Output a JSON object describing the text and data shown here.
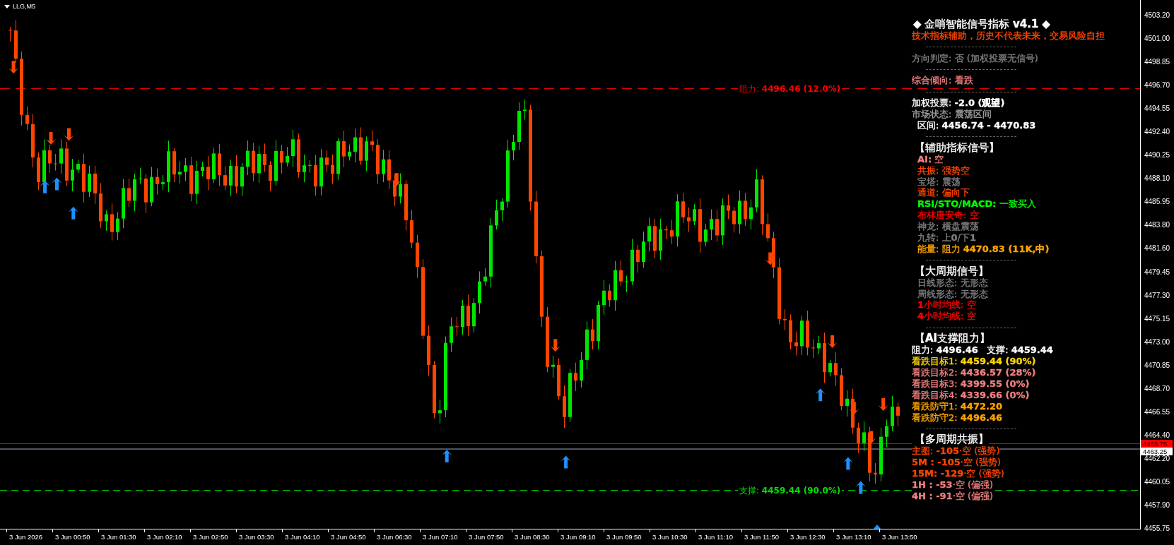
{
  "symbol": "LLG,M5",
  "levels": [
    {
      "kind": "resistance",
      "label": "阻力: **4496.46 (12.0%)**",
      "color": "#ff0000"
    },
    {
      "kind": "support",
      "label": "支撑: **4459.44 (90.0%)**",
      "color": "#00e000"
    }
  ],
  "price_axis": {
    "labels": [
      "4503.20",
      "4501.00",
      "4498.85",
      "4496.70",
      "4494.55",
      "4492.40",
      "4490.25",
      "4488.10",
      "4485.95",
      "4483.80",
      "4481.60",
      "4479.45",
      "4477.30",
      "4475.15",
      "4473.00",
      "4470.85",
      "4468.70",
      "4466.55",
      "4464.40",
      "4462.20",
      "4460.05",
      "4457.90",
      "4455.75"
    ],
    "ask": "4463.75",
    "bid": "4463.25"
  },
  "time_axis": [
    "3 Jun 2026",
    "3 Jun 00:50",
    "3 Jun 01:30",
    "3 Jun 02:10",
    "3 Jun 02:50",
    "3 Jun 03:30",
    "3 Jun 04:10",
    "3 Jun 04:50",
    "3 Jun 06:30",
    "3 Jun 07:10",
    "3 Jun 07:50",
    "3 Jun 08:30",
    "3 Jun 09:10",
    "3 Jun 09:50",
    "3 Jun 10:30",
    "3 Jun 11:10",
    "3 Jun 11:50",
    "3 Jun 12:30",
    "3 Jun 13:10",
    "3 Jun 13:50"
  ],
  "panel": {
    "rows": [
      {
        "kind": "title",
        "text": "◆ 金哨智能信号指标 **v4.1** ◆",
        "color": "#ffffff"
      },
      {
        "kind": "line",
        "text": "技术指标辅助，历史不代表未来，交易风险自担",
        "color": "#ff4500"
      },
      {
        "kind": "separator"
      },
      {
        "kind": "line",
        "text": "方向判定: 否 (加权投票无信号)",
        "color": "#808080"
      },
      {
        "kind": "separator"
      },
      {
        "kind": "line",
        "text": "综合倾向: 看跌",
        "color": "#f08080"
      },
      {
        "kind": "separator"
      },
      {
        "kind": "line",
        "text": "加权投票: **-2.0 (观望)**",
        "color": "#ffffff"
      },
      {
        "kind": "line",
        "text": "市场状态: 震荡区间",
        "color": "#a0a0a0"
      },
      {
        "kind": "item",
        "text": "区间: **4456.74 - 4470.83**",
        "color": "#ffffff"
      },
      {
        "kind": "separator"
      },
      {
        "kind": "heading",
        "text": "【辅助指标信号】",
        "color": "#ffffff"
      },
      {
        "kind": "item",
        "text": "**AI:** 空",
        "color": "#f08080"
      },
      {
        "kind": "item",
        "text": "共振: 强势空",
        "color": "#ff4500"
      },
      {
        "kind": "item",
        "text": "宝塔: 震荡",
        "color": "#808080"
      },
      {
        "kind": "item",
        "text": "通道: 偏向下",
        "color": "#ff4500"
      },
      {
        "kind": "item",
        "text": "**RSI/STO/MACD:** 一致买入",
        "color": "#00ff00"
      },
      {
        "kind": "item",
        "text": "布林唐安奇: 空",
        "color": "#ff0000"
      },
      {
        "kind": "item",
        "text": "神龙: 横盘震荡",
        "color": "#808080"
      },
      {
        "kind": "item",
        "text": "九转: 上**0**/下**1**",
        "color": "#808080"
      },
      {
        "kind": "item",
        "text": "能量: 阻力 **4470.83 (11K,中)**",
        "color": "#ffa500"
      },
      {
        "kind": "separator"
      },
      {
        "kind": "heading",
        "text": "【大周期信号】",
        "color": "#ffffff"
      },
      {
        "kind": "item",
        "text": "日线形态: 无形态",
        "color": "#808080"
      },
      {
        "kind": "item",
        "text": "周线形态: 无形态",
        "color": "#808080"
      },
      {
        "kind": "item",
        "text": "**1**小时均线: 空",
        "color": "#ff0000"
      },
      {
        "kind": "item",
        "text": "**4**小时均线: 空",
        "color": "#ff0000"
      },
      {
        "kind": "separator"
      },
      {
        "kind": "heading",
        "text": "【**AI**支撑阻力】",
        "color": "#ffffff"
      },
      {
        "kind": "line",
        "text": "阻力: **4496.46**   支撑: **4459.44**",
        "color": "#ffffff"
      },
      {
        "kind": "line",
        "text": "看跌目标1: **4459.44 (90%)**",
        "color": "#ffd700"
      },
      {
        "kind": "line",
        "text": "看跌目标2: **4436.57 (28%)**",
        "color": "#f08080"
      },
      {
        "kind": "line",
        "text": "看跌目标3: **4399.55 (0%)**",
        "color": "#f08080"
      },
      {
        "kind": "line",
        "text": "看跌目标4: **4339.66 (0%)**",
        "color": "#f08080"
      },
      {
        "kind": "line",
        "text": "看跌防守1: **4472.20**",
        "color": "#ffa500"
      },
      {
        "kind": "line",
        "text": "看跌防守2: **4496.46**",
        "color": "#ffa500"
      },
      {
        "kind": "separator"
      },
      {
        "kind": "heading",
        "text": "【多周期共振】",
        "color": "#ffffff"
      },
      {
        "kind": "line",
        "text": "主图: **-105**·空 (强势)",
        "color": "#ff4500"
      },
      {
        "kind": "line",
        "text": "**5M : -105**·空 (强势)",
        "color": "#ff4500"
      },
      {
        "kind": "line",
        "text": "**15M: -129**·空 (强势)",
        "color": "#ff4500"
      },
      {
        "kind": "line",
        "text": "**1H : -53**·空 (偏强)",
        "color": "#f08080"
      },
      {
        "kind": "line",
        "text": "**4H : -91**·空 (偏强)",
        "color": "#f08080"
      }
    ]
  }
}
